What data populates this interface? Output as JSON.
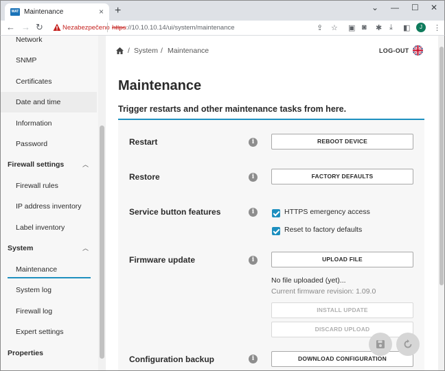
{
  "browser": {
    "tab_title": "Maintenance",
    "tab_close": "×",
    "new_tab": "+",
    "win_min": "⌄",
    "win_min2": "—",
    "win_max": "☐",
    "win_close": "✕",
    "security_label": "Nezabezpečeno",
    "url_scheme": "https",
    "url_rest": "://10.10.10.14/ui/system/maintenance",
    "profile_initial": "J",
    "favicon_text": "WAT"
  },
  "sidebar": {
    "items": [
      {
        "label": "Network"
      },
      {
        "label": "SNMP"
      },
      {
        "label": "Certificates"
      },
      {
        "label": "Date and time"
      },
      {
        "label": "Information"
      },
      {
        "label": "Password"
      },
      {
        "label": "Firewall settings"
      },
      {
        "label": "Firewall rules"
      },
      {
        "label": "IP address inventory"
      },
      {
        "label": "Label inventory"
      },
      {
        "label": "System"
      },
      {
        "label": "Maintenance"
      },
      {
        "label": "System log"
      },
      {
        "label": "Firewall log"
      },
      {
        "label": "Expert settings"
      },
      {
        "label": "Properties"
      }
    ]
  },
  "header": {
    "breadcrumb_system": "System",
    "breadcrumb_sep": "/",
    "breadcrumb_page": "Maintenance",
    "logout": "LOG-OUT"
  },
  "main": {
    "title": "Maintenance",
    "subtitle": "Trigger restarts and other maintenance tasks from here.",
    "info_glyph": "i",
    "restart": {
      "label": "Restart",
      "button": "REBOOT DEVICE"
    },
    "restore": {
      "label": "Restore",
      "button": "FACTORY DEFAULTS"
    },
    "service": {
      "label": "Service button features",
      "opt1": "HTTPS emergency access",
      "opt2": "Reset to factory defaults"
    },
    "firmware": {
      "label": "Firmware update",
      "upload": "UPLOAD FILE",
      "status": "No file uploaded (yet)...",
      "revision": "Current firmware revision: 1.09.0",
      "install": "INSTALL UPDATE",
      "discard": "DISCARD UPLOAD"
    },
    "backup": {
      "label": "Configuration backup",
      "button": "DOWNLOAD CONFIGURATION"
    }
  }
}
